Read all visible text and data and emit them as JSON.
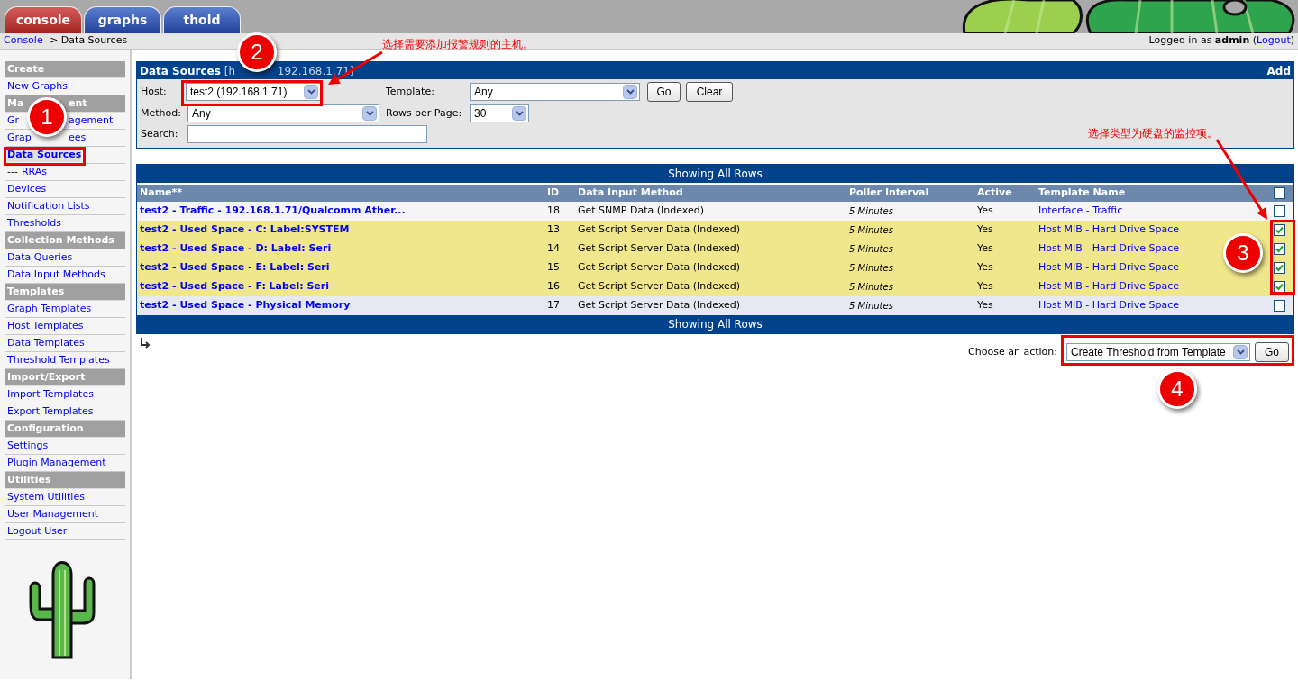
{
  "tabs": [
    {
      "label": "console",
      "selected": true
    },
    {
      "label": "graphs",
      "selected": false
    },
    {
      "label": "thold",
      "selected": false
    }
  ],
  "breadcrumb": {
    "link": "Console",
    "current": "-> Data Sources"
  },
  "login": {
    "prefix": "Logged in as",
    "user": "admin",
    "paren_open": "(",
    "logout": "Logout",
    "paren_close": ")"
  },
  "sidebar": [
    {
      "kind": "header",
      "label": "Create"
    },
    {
      "kind": "link",
      "label": "New Graphs",
      "selected": false
    },
    {
      "kind": "covered_header",
      "parts": [
        "Ma",
        "ent"
      ]
    },
    {
      "kind": "covered_link",
      "parts": [
        "Gr",
        "agement"
      ],
      "selected": false
    },
    {
      "kind": "covered_link",
      "parts": [
        "Grap",
        "ees"
      ],
      "selected": false
    },
    {
      "kind": "link",
      "label": "Data Sources",
      "selected": true
    },
    {
      "kind": "sublink",
      "prefix": "---",
      "label": "RRAs",
      "selected": false
    },
    {
      "kind": "link",
      "label": "Devices",
      "selected": false
    },
    {
      "kind": "link",
      "label": "Notification Lists",
      "selected": false
    },
    {
      "kind": "link",
      "label": "Thresholds",
      "selected": false
    },
    {
      "kind": "header",
      "label": "Collection Methods"
    },
    {
      "kind": "link",
      "label": "Data Queries",
      "selected": false
    },
    {
      "kind": "link",
      "label": "Data Input Methods",
      "selected": false
    },
    {
      "kind": "header",
      "label": "Templates"
    },
    {
      "kind": "link",
      "label": "Graph Templates",
      "selected": false
    },
    {
      "kind": "link",
      "label": "Host Templates",
      "selected": false
    },
    {
      "kind": "link",
      "label": "Data Templates",
      "selected": false
    },
    {
      "kind": "link",
      "label": "Threshold Templates",
      "selected": false
    },
    {
      "kind": "header",
      "label": "Import/Export"
    },
    {
      "kind": "link",
      "label": "Import Templates",
      "selected": false
    },
    {
      "kind": "link",
      "label": "Export Templates",
      "selected": false
    },
    {
      "kind": "header",
      "label": "Configuration"
    },
    {
      "kind": "link",
      "label": "Settings",
      "selected": false
    },
    {
      "kind": "link",
      "label": "Plugin Management",
      "selected": false
    },
    {
      "kind": "header",
      "label": "Utilities"
    },
    {
      "kind": "link",
      "label": "System Utilities",
      "selected": false
    },
    {
      "kind": "link",
      "label": "User Management",
      "selected": false
    },
    {
      "kind": "link",
      "label": "Logout User",
      "selected": false
    }
  ],
  "filter": {
    "title": "Data Sources",
    "title_host": [
      "[h",
      "192.168.1.71]"
    ],
    "add": "Add",
    "host_label": "Host:",
    "host": "test2 (192.168.1.71)",
    "template_label": "Template:",
    "template": "Any",
    "go": "Go",
    "clear": "Clear",
    "method_label": "Method:",
    "method": "Any",
    "rows_label": "Rows per Page:",
    "rows": "30",
    "search_label": "Search:"
  },
  "table": {
    "banner": "Showing All Rows",
    "footer_banner": "Showing All Rows",
    "columns": [
      "Name**",
      "ID",
      "Data Input Method",
      "Poller Interval",
      "Active",
      "Template Name"
    ],
    "select_all_checked": false,
    "rows": [
      {
        "name": "test2 - Traffic - 192.168.1.71/Qualcomm Ather...",
        "id": "18",
        "method": "Get SNMP Data (Indexed)",
        "poller": "5 Minutes",
        "active": "Yes",
        "template": "Interface - Traffic",
        "checked": false
      },
      {
        "name": "test2 - Used Space - C: Label:SYSTEM",
        "id": "13",
        "method": "Get Script Server Data (Indexed)",
        "poller": "5 Minutes",
        "active": "Yes",
        "template": "Host MIB - Hard Drive Space",
        "checked": true
      },
      {
        "name": "test2 - Used Space - D: Label: Seri",
        "id": "14",
        "method": "Get Script Server Data (Indexed)",
        "poller": "5 Minutes",
        "active": "Yes",
        "template": "Host MIB - Hard Drive Space",
        "checked": true
      },
      {
        "name": "test2 - Used Space - E: Label: Seri",
        "id": "15",
        "method": "Get Script Server Data (Indexed)",
        "poller": "5 Minutes",
        "active": "Yes",
        "template": "Host MIB - Hard Drive Space",
        "checked": true
      },
      {
        "name": "test2 - Used Space - F: Label: Seri",
        "id": "16",
        "method": "Get Script Server Data (Indexed)",
        "poller": "5 Minutes",
        "active": "Yes",
        "template": "Host MIB - Hard Drive Space",
        "checked": true
      },
      {
        "name": "test2 - Used Space - Physical Memory",
        "id": "17",
        "method": "Get Script Server Data (Indexed)",
        "poller": "5 Minutes",
        "active": "Yes",
        "template": "Host MIB - Hard Drive Space",
        "checked": false
      }
    ]
  },
  "action": {
    "label": "Choose an action:",
    "value": "Create Threshold from Template",
    "go": "Go"
  },
  "annotations": {
    "callouts": [
      "1",
      "2",
      "3",
      "4"
    ],
    "notes": [
      "选择需要添加报警规则的主机。",
      "选择类型为硬盘的监控项。"
    ]
  }
}
